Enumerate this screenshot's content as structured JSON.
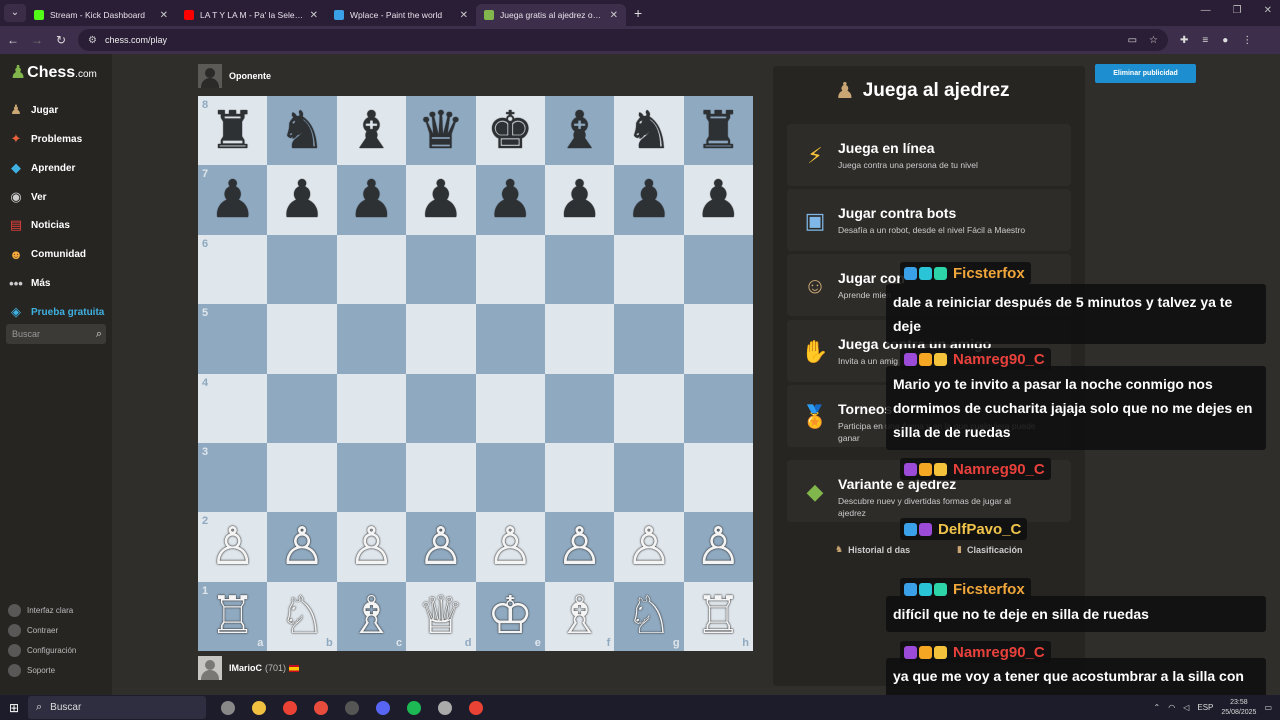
{
  "browser": {
    "tabs": [
      {
        "title": "Stream - Kick Dashboard",
        "fav_color": "#53fc18"
      },
      {
        "title": "LA T Y LA M - Pa' la Selección (",
        "fav_color": "#ff0000"
      },
      {
        "title": "Wplace - Paint the world",
        "fav_color": "#3aa0e8"
      },
      {
        "title": "Juega gratis al ajedrez online c",
        "fav_color": "#81b64c"
      }
    ],
    "url": "chess.com/play"
  },
  "sidebar": {
    "logo_text": "Chess",
    "logo_domain": ".com",
    "items": [
      {
        "label": "Jugar",
        "icon": "♟"
      },
      {
        "label": "Problemas",
        "icon": "✦"
      },
      {
        "label": "Aprender",
        "icon": "◆"
      },
      {
        "label": "Ver",
        "icon": "◉"
      },
      {
        "label": "Noticias",
        "icon": "▤"
      },
      {
        "label": "Comunidad",
        "icon": "☻"
      },
      {
        "label": "Más",
        "icon": "•••"
      },
      {
        "label": "Prueba gratuita",
        "icon": "◈"
      }
    ],
    "search_placeholder": "Buscar",
    "bottom": [
      {
        "label": "Interfaz clara"
      },
      {
        "label": "Contraer"
      },
      {
        "label": "Configuración"
      },
      {
        "label": "Soporte"
      }
    ]
  },
  "game": {
    "opponent_name": "Oponente",
    "player_name": "IMarioC",
    "player_rating": "(701)",
    "ranks": [
      "8",
      "7",
      "6",
      "5",
      "4",
      "3",
      "2",
      "1"
    ],
    "files": [
      "a",
      "b",
      "c",
      "d",
      "e",
      "f",
      "g",
      "h"
    ],
    "position": [
      [
        "♜",
        "♞",
        "♝",
        "♛",
        "♚",
        "♝",
        "♞",
        "♜"
      ],
      [
        "♟",
        "♟",
        "♟",
        "♟",
        "♟",
        "♟",
        "♟",
        "♟"
      ],
      [
        "",
        "",
        "",
        "",
        "",
        "",
        "",
        ""
      ],
      [
        "",
        "",
        "",
        "",
        "",
        "",
        "",
        ""
      ],
      [
        "",
        "",
        "",
        "",
        "",
        "",
        "",
        ""
      ],
      [
        "",
        "",
        "",
        "",
        "",
        "",
        "",
        ""
      ],
      [
        "♙",
        "♙",
        "♙",
        "♙",
        "♙",
        "♙",
        "♙",
        "♙"
      ],
      [
        "♖",
        "♘",
        "♗",
        "♕",
        "♔",
        "♗",
        "♘",
        "♖"
      ]
    ]
  },
  "panel": {
    "title": "Juega al ajedrez",
    "cards": [
      {
        "title": "Juega en línea",
        "desc": "Juega contra una persona de tu nivel",
        "icon": "⚡",
        "icon_color": "#f5c33b"
      },
      {
        "title": "Jugar contra bots",
        "desc": "Desafía a un robot, desde el nivel Fácil a Maestro",
        "icon": "▣",
        "icon_color": "#7fb8e8"
      },
      {
        "title": "Jugar con",
        "desc": "Aprende mien",
        "icon": "☺",
        "icon_color": "#c9a673"
      },
      {
        "title": "Juega contra un amigo",
        "desc": "Invita a un amig",
        "icon": "✋",
        "icon_color": "#c9a673"
      },
      {
        "title": "Torneos",
        "desc": "Participa en una Arena y en la que cualquiera puede ganar",
        "icon": "🏅",
        "icon_color": "#f5c33b"
      },
      {
        "title": "Variante   e ajedrez",
        "desc": "Descubre nuev   y divertidas formas de jugar al ajedrez",
        "icon": "◆",
        "icon_color": "#81b64c"
      }
    ],
    "footer_left": "Historial d   das",
    "footer_right": "Clasificación",
    "ad_button": "Eliminar publicidad"
  },
  "chat": [
    {
      "user": "Ficsterfox",
      "user_color": "#f0a63b",
      "badges": [
        "#3aa0e8",
        "#29c5d6",
        "#2dd4a8"
      ],
      "text": "dale a reiniciar después de 5 minutos y talvez ya te deje"
    },
    {
      "user": "Namreg90_C",
      "user_color": "#e8413c",
      "badges": [
        "#9b4bd8",
        "#f5a623",
        "#f5c33b"
      ],
      "text": "Mario yo te invito a pasar la noche conmigo nos dormimos de cucharita jajaja solo que no me dejes en silla de de ruedas"
    },
    {
      "user": "Namreg90_C",
      "user_color": "#e8413c",
      "badges": [
        "#9b4bd8",
        "#f5a623",
        "#f5c33b"
      ],
      "text": ""
    },
    {
      "user": "DelfPavo_C",
      "user_color": "#f0c44b",
      "badges": [
        "#3aa0e8",
        "#9b4bd8"
      ],
      "text": ""
    },
    {
      "user": "Ficsterfox",
      "user_color": "#f0a63b",
      "badges": [
        "#3aa0e8",
        "#29c5d6",
        "#2dd4a8"
      ],
      "text": "difícil que no te deje en silla de ruedas"
    },
    {
      "user": "Namreg90_C",
      "user_color": "#e8413c",
      "badges": [
        "#9b4bd8",
        "#f5a623",
        "#f5c33b"
      ],
      "text": "ya que me voy a tener que acostumbrar a la silla con ruedas jajaja"
    }
  ],
  "taskbar": {
    "search": "Buscar",
    "apps": [
      "#888",
      "#f0c040",
      "#ea4335",
      "#e84c3d",
      "#555",
      "#5865f2",
      "#1db954",
      "#aaa",
      "#ea4335"
    ],
    "lang": "ESP",
    "time": "23:58",
    "date": "25/08/2025"
  }
}
